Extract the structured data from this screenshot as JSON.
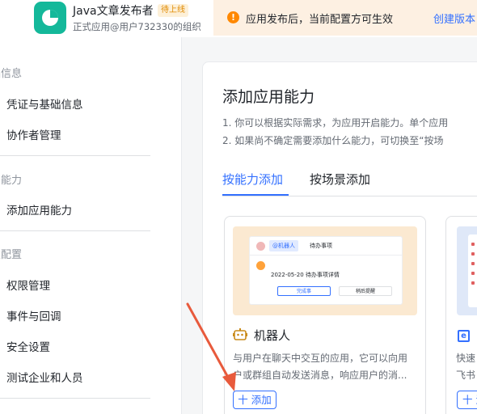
{
  "app": {
    "name": "Java文章发布者",
    "badge": "待上线",
    "subtitle": "正式应用@用户732330的组织"
  },
  "notice": {
    "icon": "exclamation-icon",
    "text": "应用发布后，当前配置方可生效",
    "link": "创建版本"
  },
  "sidebar": {
    "groups": [
      {
        "title": "础信息",
        "items": [
          "凭证与基础信息",
          "协作者管理"
        ]
      },
      {
        "title": "用能力",
        "items": [
          "添加应用能力"
        ]
      },
      {
        "title": "发配置",
        "items": [
          "权限管理",
          "事件与回调",
          "安全设置",
          "测试企业和人员"
        ]
      }
    ]
  },
  "main": {
    "title": "添加应用能力",
    "desc_lines": [
      "1. 你可以根据实际需求，为应用开启能力。单个应用",
      "2. 如果尚不确定需要添加什么能力，可切换至“按场"
    ],
    "tabs": [
      {
        "label": "按能力添加",
        "active": true
      },
      {
        "label": "按场景添加",
        "active": false
      }
    ]
  },
  "cards": [
    {
      "title": "机器人",
      "icon": "robot-icon",
      "desc_lines": [
        "与用户在聊天中交互的应用，它可以向用",
        "户或群组自动发送消息，响应用户的消..."
      ],
      "button": "十 添加",
      "preview": {
        "tag": "@机器人",
        "todo": "待办事项",
        "date_line": "2022-05-20 待办事项详情",
        "btn_done": "完成事",
        "btn_later": "稍后提醒"
      }
    },
    {
      "title": "",
      "icon": "e-doc-icon",
      "desc_lines": [
        "快速",
        "飞书"
      ],
      "button": "十 添"
    }
  ],
  "colors": {
    "accent": "#3370ff",
    "app_logo": "#14b89a",
    "notice_bg": "#fdf0e2",
    "warning": "#ff8800",
    "arrow": "#e85a3c"
  }
}
